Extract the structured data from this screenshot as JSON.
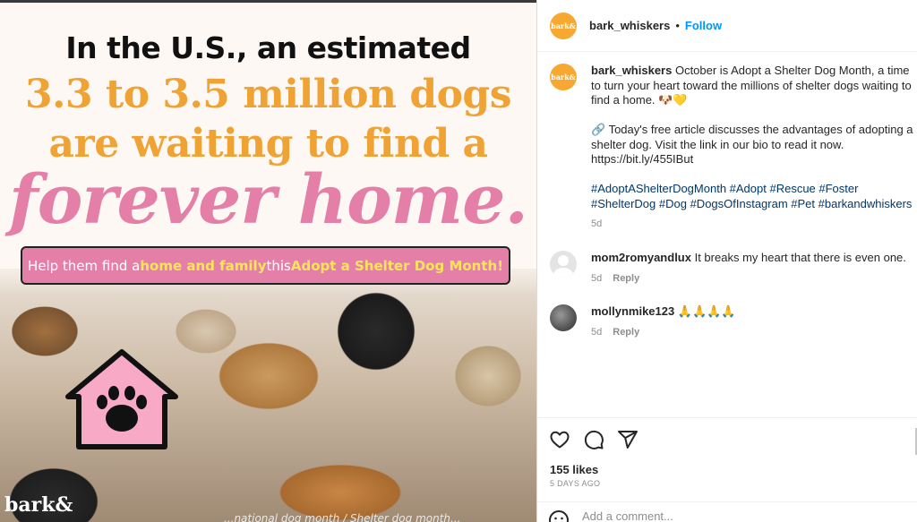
{
  "post_image": {
    "headline_line1": "In the U.S., an estimated",
    "headline_line2": "3.3 to 3.5 million dogs",
    "headline_line3": "are waiting to find a",
    "headline_line4": "forever home.",
    "banner_part1": "Help them find a ",
    "banner_highlight1": "home and family",
    "banner_part2": " this ",
    "banner_highlight2": "Adopt a Shelter Dog Month!",
    "brand_logo": "bark&",
    "bottom_overlay": "...national dog month / Shelter dog month..."
  },
  "header": {
    "avatar_text": "bark&",
    "username": "bark_whiskers",
    "separator": "•",
    "follow_label": "Follow"
  },
  "caption": {
    "username": "bark_whiskers",
    "text_line1": " October is Adopt a Shelter Dog Month, a time to turn your heart toward the millions of shelter dogs waiting to find a home. 🐶💛",
    "text_line2": "🔗 Today's free article discusses the advantages of adopting a shelter dog. Visit the link in our bio to read it now. https://bit.ly/455IBut",
    "hashtags": "#AdoptAShelterDogMonth #Adopt #Rescue #Foster #ShelterDog #Dog #DogsOfInstagram #Pet #barkandwhiskers",
    "time": "5d"
  },
  "comments": [
    {
      "username": "mom2romyandlux",
      "text": " It breaks my heart that there is even one.",
      "time": "5d",
      "reply_label": "Reply"
    },
    {
      "username": "mollynmike123",
      "text": " 🙏🙏🙏🙏",
      "time": "5d",
      "reply_label": "Reply"
    }
  ],
  "actions": {
    "like_icon": "heart-icon",
    "comment_icon": "comment-icon",
    "share_icon": "share-icon"
  },
  "likes_text": "155 likes",
  "post_date": "5 DAYS AGO",
  "add_comment": {
    "placeholder": "Add a comment...",
    "emoji_icon": "smiley-icon"
  },
  "colors": {
    "brand_orange": "#f7a831",
    "headline_orange": "#f0a335",
    "headline_pink": "#e47fa7",
    "follow_blue": "#0095f6",
    "hashtag_blue": "#00376b"
  }
}
